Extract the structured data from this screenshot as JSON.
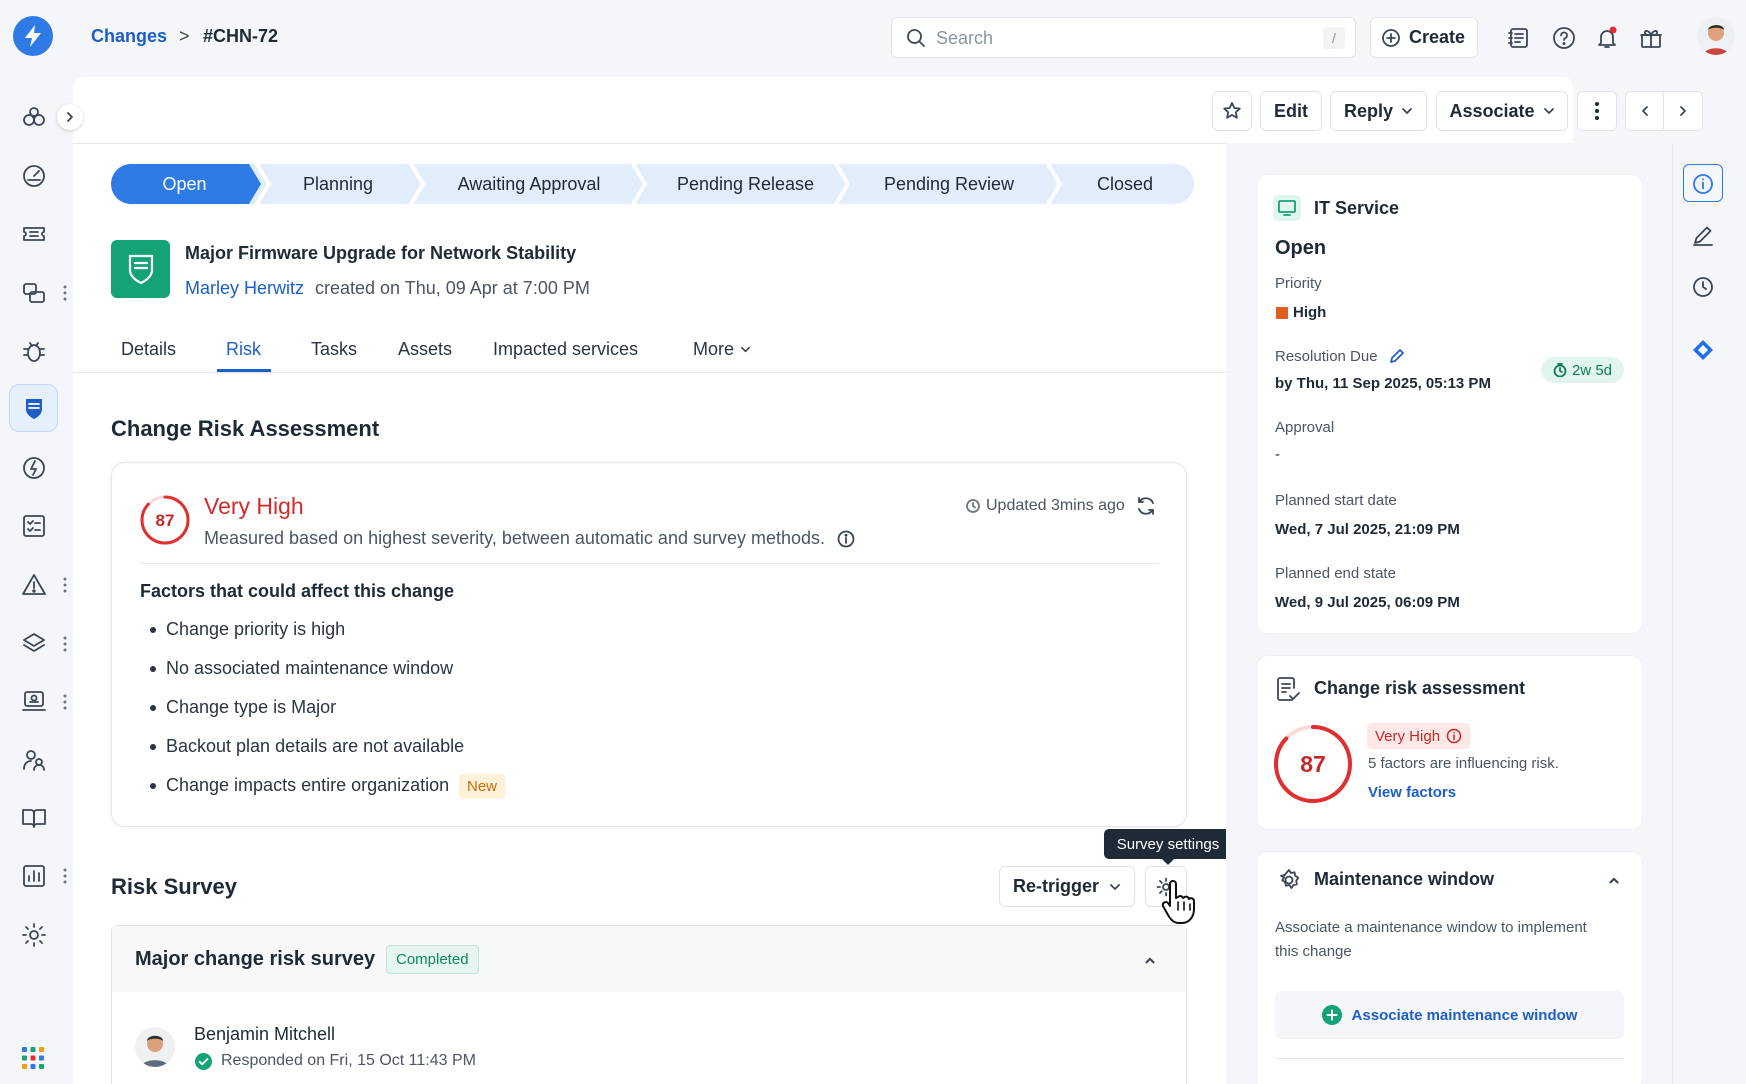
{
  "breadcrumb": {
    "changes": "Changes",
    "separator": ">",
    "id": "#CHN-72"
  },
  "search": {
    "placeholder": "Search",
    "shortcut": "/"
  },
  "header": {
    "create_label": "Create"
  },
  "toolbar": {
    "edit": "Edit",
    "reply": "Reply",
    "associate": "Associate"
  },
  "stepper": {
    "steps": [
      "Open",
      "Planning",
      "Awaiting Approval",
      "Pending Release",
      "Pending Review",
      "Closed"
    ],
    "active_index": 0
  },
  "change": {
    "title": "Major Firmware Upgrade for Network Stability",
    "author": "Marley Herwitz",
    "meta": "created on Thu, 09 Apr at 7:00 PM"
  },
  "tabs": [
    "Details",
    "Risk",
    "Tasks",
    "Assets",
    "Impacted services",
    "More"
  ],
  "active_tab": "Risk",
  "risk": {
    "section_title": "Change Risk Assessment",
    "score": "87",
    "score_fraction": 0.87,
    "level": "Very High",
    "description": "Measured based on highest severity, between automatic and survey methods.",
    "updated": "Updated 3mins ago",
    "factors_title": "Factors that could affect this change",
    "factors": [
      "Change priority is high",
      "No associated maintenance window",
      "Change type is Major",
      "Backout plan details are not available",
      "Change impacts entire organization"
    ],
    "new_badge": "New"
  },
  "survey": {
    "section_title": "Risk Survey",
    "retrigger": "Re-trigger",
    "tooltip": "Survey settings",
    "name": "Major change risk survey",
    "status": "Completed",
    "respondent": "Benjamin Mitchell",
    "responded": "Responded on Fri, 15 Oct 11:43 PM"
  },
  "info": {
    "service": "IT Service",
    "status": "Open",
    "priority_label": "Priority",
    "priority": "High",
    "resolution_label": "Resolution Due",
    "resolution_value": "by Thu, 11 Sep 2025, 05:13 PM",
    "due_badge": "2w 5d",
    "approval_label": "Approval",
    "approval_value": "-",
    "start_label": "Planned start date",
    "start_value": "Wed, 7 Jul 2025, 21:09 PM",
    "end_label": "Planned end state",
    "end_value": "Wed, 9 Jul 2025, 06:09 PM"
  },
  "risk_card": {
    "title": "Change risk assessment",
    "score": "87",
    "level": "Very High",
    "text": "5 factors are influencing risk.",
    "link": "View factors"
  },
  "maintenance": {
    "title": "Maintenance window",
    "description_line1": "Associate a maintenance window to implement",
    "description_line2": "this change",
    "button": "Associate maintenance window"
  },
  "colors": {
    "accent": "#2f7be6",
    "danger": "#e02f2f",
    "brand_green": "#14a377",
    "priority_high": "#e05f1e"
  }
}
